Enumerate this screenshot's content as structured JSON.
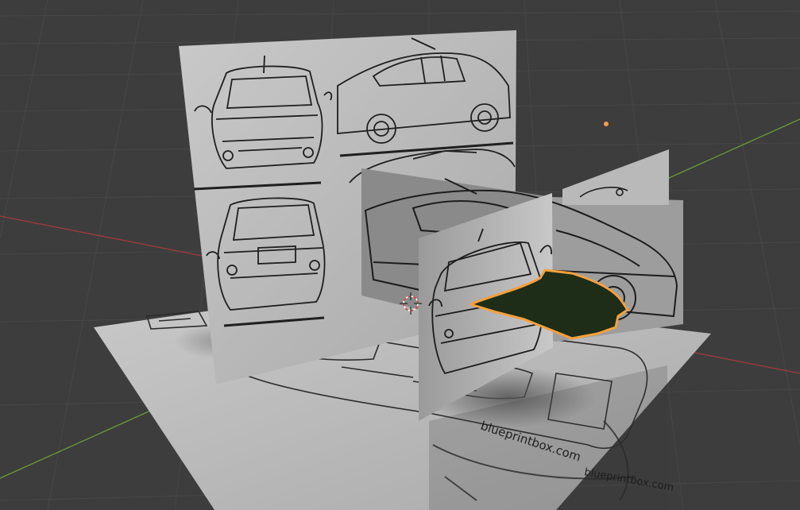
{
  "viewport": {
    "background": "#3d3d3d",
    "grid_color": "#474747",
    "x_axis_color": "#a33b3b",
    "y_axis_color": "#6a9a3a",
    "selection_color": "#f5a03c",
    "selected_mesh_fill": "#1d2d17"
  },
  "watermarks": {
    "floor": "blueprintbox.com",
    "floor_reflection": "blueprintbox.com"
  },
  "objects": {
    "cursor": "3d-cursor",
    "light": "light-object",
    "selected": "hood-mesh"
  }
}
